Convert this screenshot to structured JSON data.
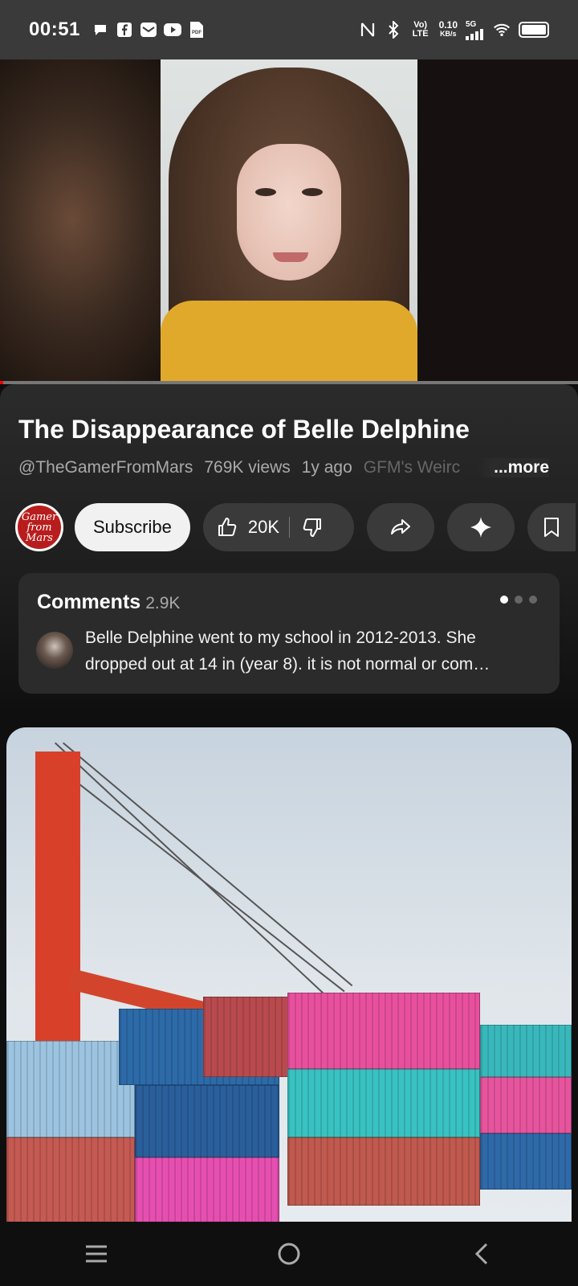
{
  "status_bar": {
    "time": "00:51",
    "notification_icons": [
      "chat-icon",
      "facebook-icon",
      "mail-icon",
      "youtube-icon",
      "pdf-icon"
    ],
    "system_icons": [
      "nfc-icon",
      "bluetooth-icon",
      "volte-icon",
      "net-speed",
      "signal-5g-icon",
      "wifi-icon",
      "battery-icon"
    ],
    "volte_text": "Vo) LTE",
    "net_speed": "0.10",
    "net_unit": "KB/s",
    "network_type": "5G"
  },
  "video": {
    "title": "The Disappearance of Belle Delphine",
    "progress": 0.005
  },
  "meta": {
    "channel_handle": "@TheGamerFromMars",
    "views": "769K views",
    "age": "1y ago",
    "playlist": "GFM's Weirc",
    "more_label": "...more"
  },
  "channel": {
    "avatar_text": "Gamer from Mars"
  },
  "actions": {
    "subscribe_label": "Subscribe",
    "like_count": "20K"
  },
  "comments": {
    "heading": "Comments",
    "count": "2.9K",
    "page_dots": 3,
    "active_dot": 0,
    "top_comment": "Belle Delphine went to my school in 2012-2013. She dropped out at 14 in (year 8). it is not normal or com…"
  },
  "colors": {
    "background": "#0f0f0f",
    "accent_red": "#ff0000",
    "pill_bg": "#3a3a3a",
    "subscribe_bg": "#f1f1f1"
  }
}
